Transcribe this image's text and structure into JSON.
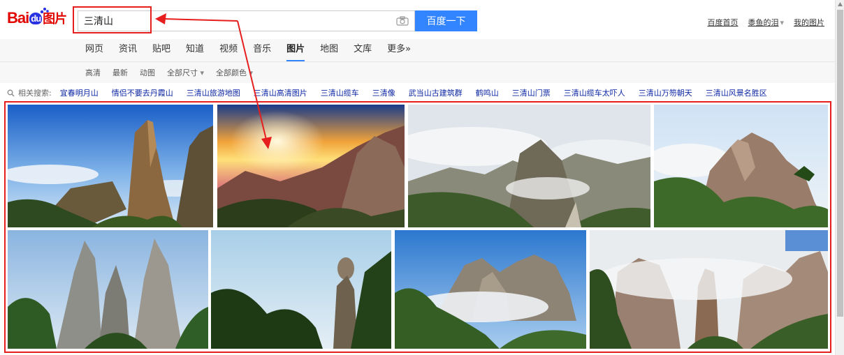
{
  "logo": {
    "bai": "Bai",
    "du": "du",
    "pic": "图片"
  },
  "search": {
    "value": "三清山",
    "button_label": "百度一下"
  },
  "top_links": {
    "home": "百度首页",
    "user": "黍鱼的泪",
    "my_images": "我的图片"
  },
  "nav": {
    "tabs": [
      "网页",
      "资讯",
      "贴吧",
      "知道",
      "视频",
      "音乐",
      "图片",
      "地图",
      "文库",
      "更多»"
    ],
    "active": "图片"
  },
  "filters": [
    "高清",
    "最新",
    "动图",
    "全部尺寸",
    "全部颜色"
  ],
  "related": {
    "label": "相关搜索:",
    "links": [
      "宜春明月山",
      "情侣不要去丹霞山",
      "三清山旅游地图",
      "三清山高清图片",
      "三清山缆车",
      "三清像",
      "武当山古建筑群",
      "鹤鸣山",
      "三清山门票",
      "三清山缆车太吓人",
      "三清山万笏朝天",
      "三清山风景名胜区"
    ]
  },
  "images": [
    {
      "alt": "三清山 巨石 蓝天"
    },
    {
      "alt": "三清山 日出 云海"
    },
    {
      "alt": "三清山 云雾 山道"
    },
    {
      "alt": "三清山 峰林"
    },
    {
      "alt": "三清山 石柱 险峰"
    },
    {
      "alt": "三清山 巨蟒出山"
    },
    {
      "alt": "三清山 云海 峰峦"
    },
    {
      "alt": "三清山 女神峰 云雾"
    }
  ],
  "colors": {
    "accent": "#3385ff",
    "annotation": "#e61e1e",
    "link": "#0c26a3"
  }
}
